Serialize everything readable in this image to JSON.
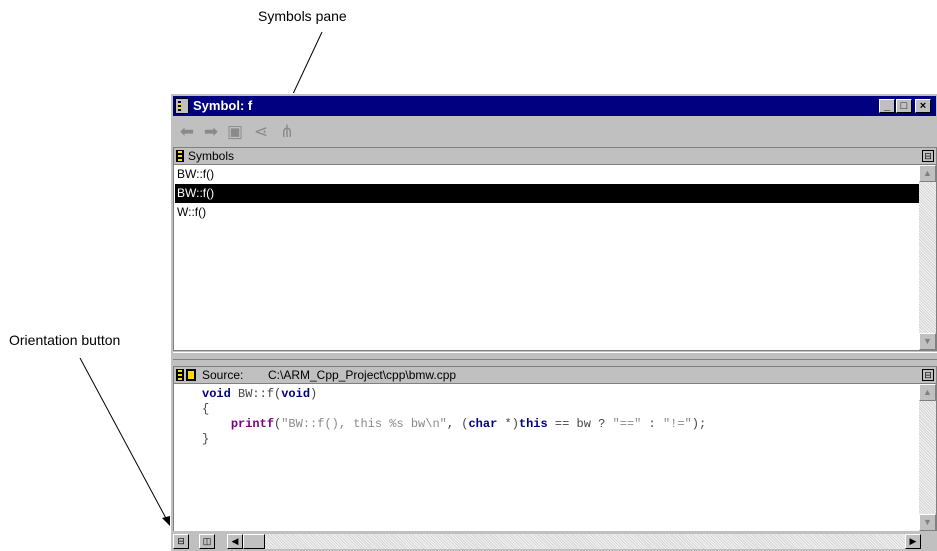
{
  "callouts": {
    "symbols_pane": "Symbols pane",
    "orientation_button": "Orientation button"
  },
  "window": {
    "title": "Symbol: f",
    "controls": {
      "minimize": "_",
      "maximize": "□",
      "close": "×"
    }
  },
  "toolbar": {
    "icons": [
      "back-arrow-icon",
      "forward-arrow-icon",
      "browse-icon",
      "call-graph-icon",
      "callers-graph-icon"
    ]
  },
  "symbols_pane": {
    "header": "Symbols",
    "items": [
      "BW::f()",
      "BW::f()",
      "W::f()"
    ],
    "selected_index": 1
  },
  "source_pane": {
    "label": "Source:",
    "path": "C:\\ARM_Cpp_Project\\cpp\\bmw.cpp",
    "code": {
      "l1_kw1": "void",
      "l1_rest": " BW::f(",
      "l1_kw2": "void",
      "l1_end": ")",
      "l2": "{",
      "l3_fn": "printf",
      "l3_a": "(",
      "l3_str1": "\"BW::f(), this %s bw\\n\"",
      "l3_b": ", (",
      "l3_kw1": "char",
      "l3_c": " *)",
      "l3_kw2": "this",
      "l3_d": " == bw ? ",
      "l3_str2": "\"==\"",
      "l3_e": " : ",
      "l3_str3": "\"!=\"",
      "l3_f": ");",
      "l4": "}"
    }
  },
  "colors": {
    "titlebar": "#000080",
    "selection": "#000000",
    "face": "#c0c0c0"
  }
}
